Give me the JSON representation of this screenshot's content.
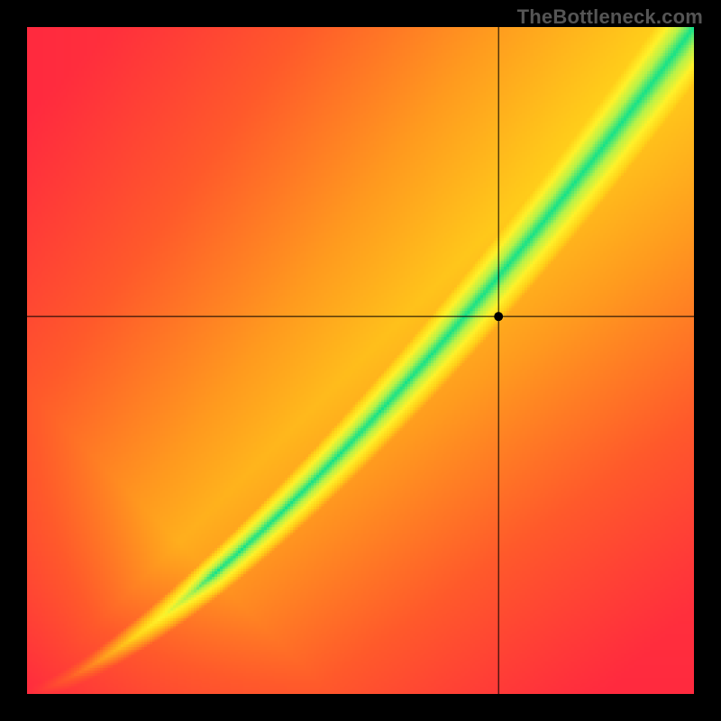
{
  "watermark": "TheBottleneck.com",
  "chart_data": {
    "type": "heatmap",
    "title": "",
    "xlabel": "",
    "ylabel": "",
    "xlim": [
      0,
      1
    ],
    "ylim": [
      0,
      1
    ],
    "grid": false,
    "legend": "none",
    "crosshair": {
      "x": 0.707,
      "y": 0.566
    },
    "marker": {
      "x": 0.707,
      "y": 0.566
    },
    "colorscale": [
      {
        "t": 0.0,
        "color": "#ff2a3f"
      },
      {
        "t": 0.18,
        "color": "#ff5a2b"
      },
      {
        "t": 0.35,
        "color": "#ff9a1f"
      },
      {
        "t": 0.52,
        "color": "#ffd21a"
      },
      {
        "t": 0.68,
        "color": "#fff22a"
      },
      {
        "t": 0.84,
        "color": "#b6f24a"
      },
      {
        "t": 1.0,
        "color": "#15e28a"
      }
    ],
    "ridge": {
      "exponent": 1.35,
      "width_base": 0.015,
      "width_gain": 0.13
    },
    "background_falloff": 1.0,
    "description": "Diagonal green band from bottom-left to top-right widening toward top-right, over a red-to-yellow gradient field; crosshair lines intersect at a single marked point."
  }
}
